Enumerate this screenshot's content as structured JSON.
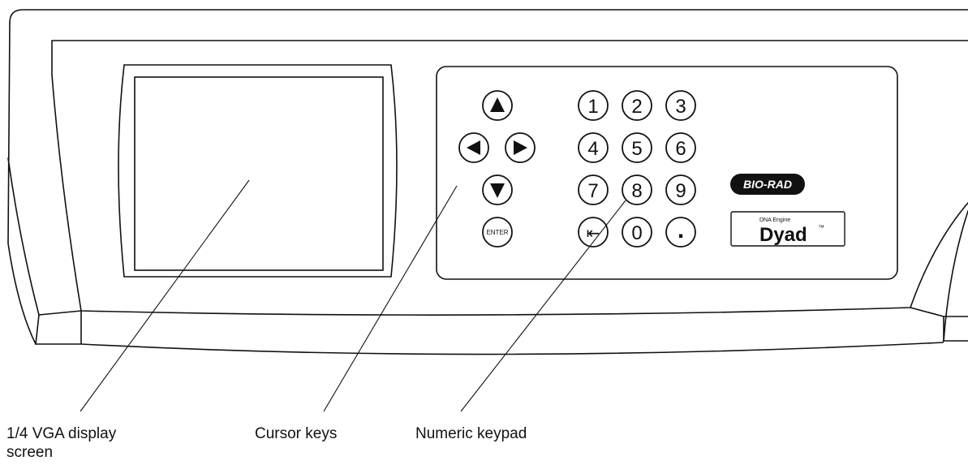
{
  "device": {
    "brand_logo": "BIO-RAD",
    "product_badge": {
      "line1": "DNA Engine",
      "name": "Dyad",
      "trademark": "™"
    }
  },
  "keypad": {
    "cursor_keys": [
      "up",
      "left",
      "right",
      "down"
    ],
    "enter_label": "ENTER",
    "digits": [
      "1",
      "2",
      "3",
      "4",
      "5",
      "6",
      "7",
      "8",
      "9",
      "0"
    ],
    "backspace_symbol": "⇤",
    "decimal_label": "."
  },
  "callouts": {
    "display_line1": "1/4 VGA display",
    "display_line2": "screen",
    "cursor_keys": "Cursor keys",
    "numeric_keypad": "Numeric keypad"
  },
  "colors": {
    "stroke": "#111111",
    "fill": "#ffffff",
    "logo_fill": "#111111",
    "logo_text": "#ffffff"
  }
}
